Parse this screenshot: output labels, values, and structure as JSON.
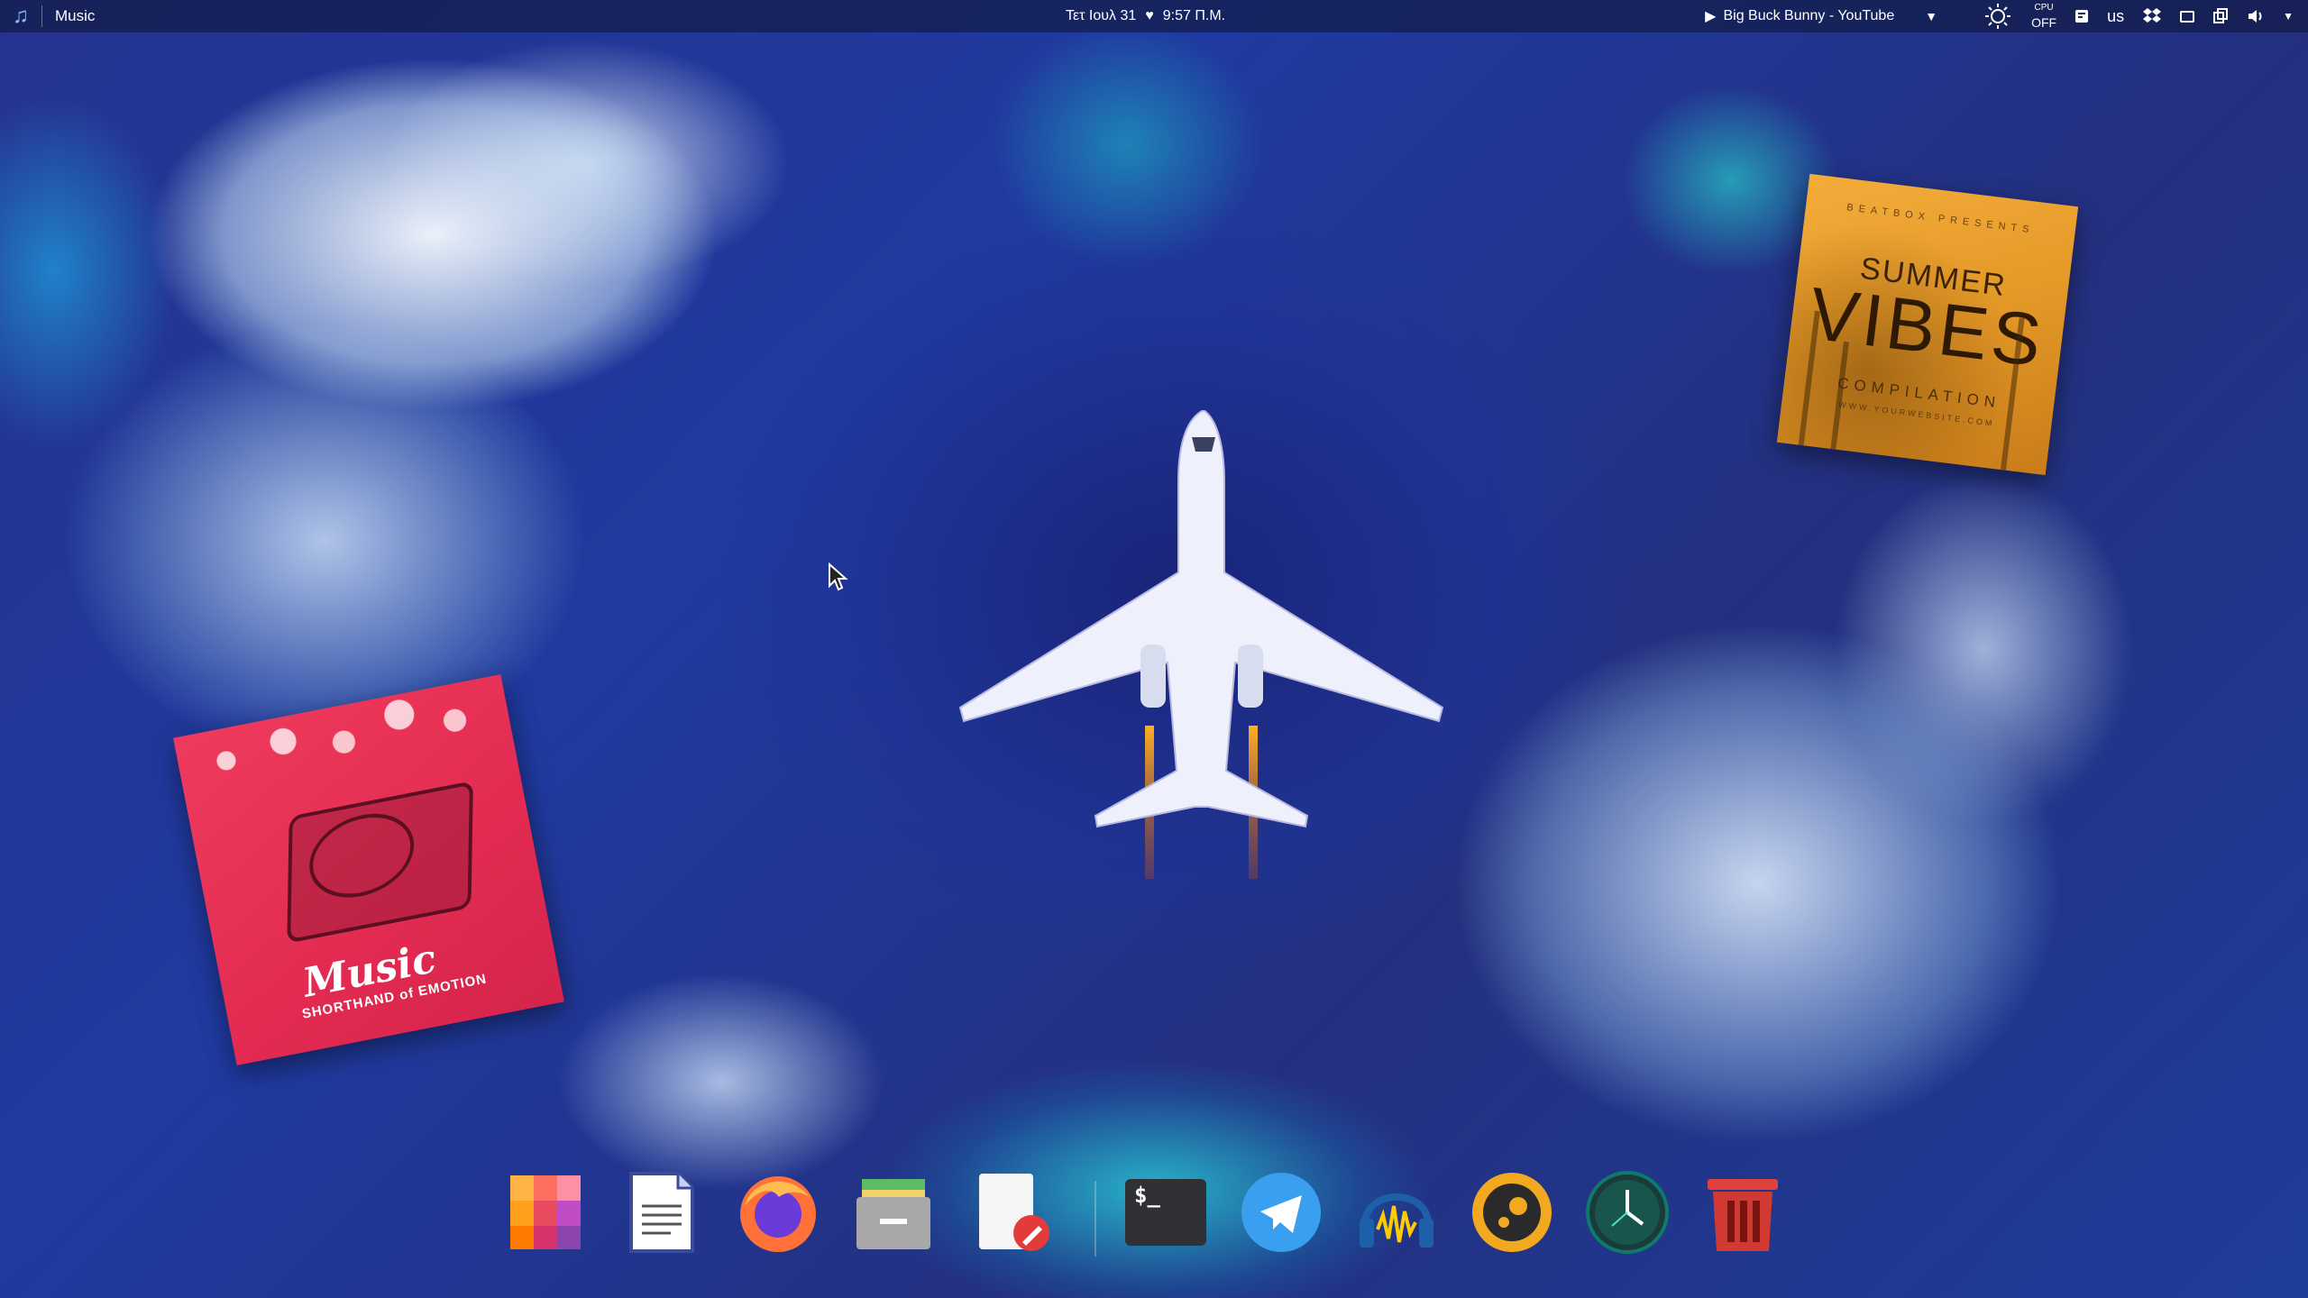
{
  "topbar": {
    "app_icon": "music-note-icon",
    "app_title": "Music",
    "date": "Τετ Ιουλ 31",
    "heart_glyph": "♥",
    "time": "9:57 Π.Μ.",
    "media_title": "Big Buck Bunny - YouTube",
    "cpu_label": "CPU",
    "cpu_value": "OFF",
    "keyboard_layout": "us"
  },
  "albums": {
    "summer": {
      "top_text": "BEATBOX PRESENTS",
      "line1": "SUMMER",
      "line2": "VIBES",
      "line3": "COMPILATION",
      "url": "WWW.YOURWEBSITE.COM"
    },
    "music": {
      "title": "Music",
      "subtitle": "SHORTHAND of EMOTION"
    }
  },
  "dock": {
    "items": [
      {
        "name": "mosaic-app-icon"
      },
      {
        "name": "text-editor-icon"
      },
      {
        "name": "firefox-icon"
      },
      {
        "name": "file-manager-icon"
      },
      {
        "name": "document-writer-icon"
      },
      {
        "name": "terminal-icon"
      },
      {
        "name": "telegram-icon"
      },
      {
        "name": "audio-player-icon"
      },
      {
        "name": "character-app-icon"
      },
      {
        "name": "clock-icon"
      },
      {
        "name": "trash-icon"
      }
    ],
    "terminal_prompt": "$_"
  },
  "colors": {
    "panel_bg": "#121c46",
    "accent_blue": "#3b8ff0",
    "summer_orange": "#e59a28",
    "music_red": "#e32b52"
  }
}
